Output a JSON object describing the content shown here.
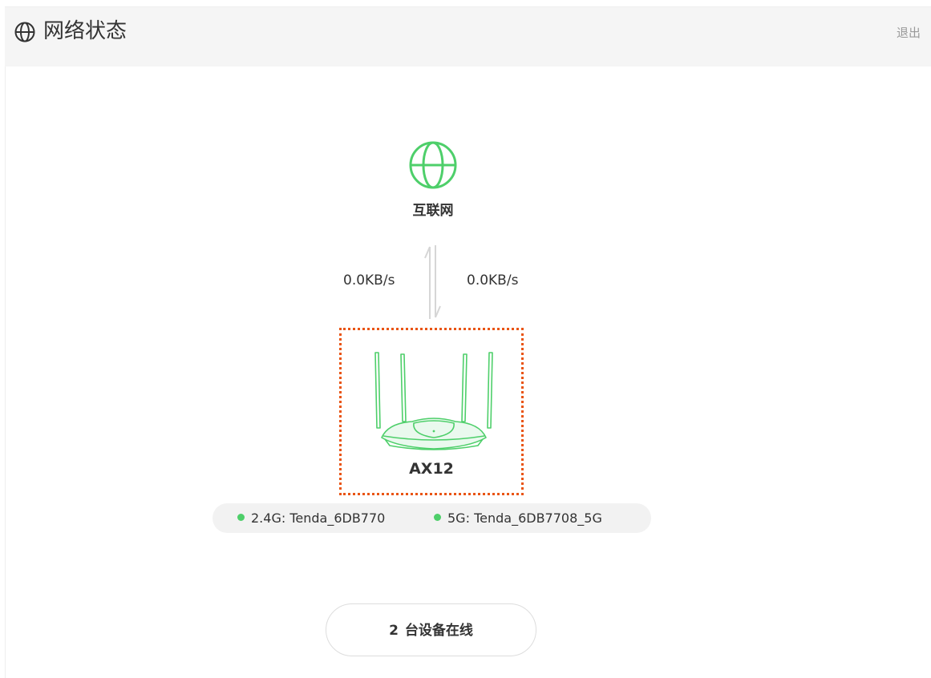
{
  "header": {
    "title": "网络状态",
    "logout_label": "退出"
  },
  "topology": {
    "internet_label": "互联网",
    "upload_rate": "0.0KB/s",
    "download_rate": "0.0KB/s",
    "router_name": "AX12"
  },
  "wifi": [
    {
      "band": "2.4G:",
      "ssid": "Tenda_6DB770",
      "status_color": "#4ecf6a"
    },
    {
      "band": "5G:",
      "ssid": "Tenda_6DB7708_5G",
      "status_color": "#4ecf6a"
    }
  ],
  "devices": {
    "count": "2",
    "label": "台设备在线"
  },
  "colors": {
    "accent_green": "#4ecf6a",
    "highlight_orange": "#e95413"
  },
  "icons": {
    "header": "globe-icon",
    "internet": "globe-icon",
    "router": "router-icon",
    "arrows": "transfer-arrows-icon"
  }
}
